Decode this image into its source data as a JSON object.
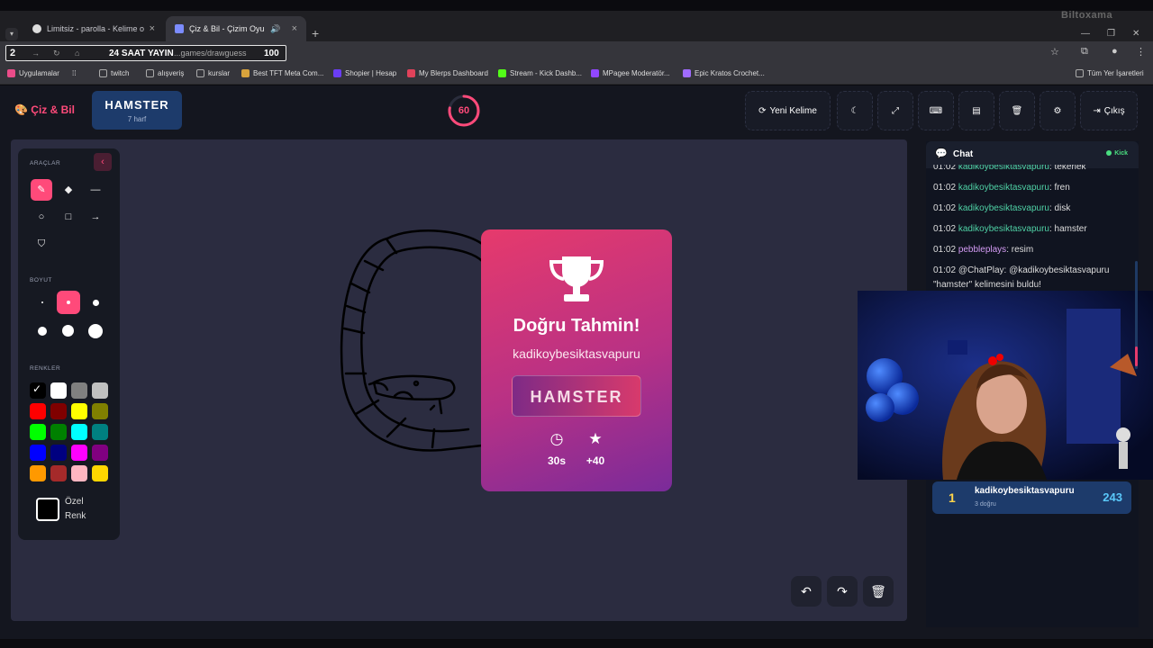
{
  "browser": {
    "tabs": [
      {
        "title": "Limitsiz - parolla - Kelime oyunu"
      },
      {
        "title": "Çiz & Bil - Çizim Oyunu"
      }
    ],
    "brand_overlay": "Biltoxama",
    "address": {
      "overlay_number": "2",
      "overlay_live": "24 SAAT YAYIN",
      "url": "...games/drawguess",
      "overlay_count": "100"
    },
    "bookmarks": [
      {
        "label": "Uygulamalar",
        "color": "#ea4c89"
      },
      {
        "label": "twitch",
        "color": "#9aa0a6"
      },
      {
        "label": "alışveriş",
        "color": "#9aa0a6"
      },
      {
        "label": "kurslar",
        "color": "#9aa0a6"
      },
      {
        "label": "Best TFT Meta Com...",
        "color": "#d8a33c"
      },
      {
        "label": "Shopier | Hesap",
        "color": "#6a3df5"
      },
      {
        "label": "My Blerps Dashboard",
        "color": "#e0425a"
      },
      {
        "label": "Stream - Kick Dashb...",
        "color": "#53fc18"
      },
      {
        "label": "MPagee Moderatör...",
        "color": "#9147ff"
      },
      {
        "label": "Epic Kratos Crochet...",
        "color": "#a06bff"
      },
      {
        "label": "Tüm Yer İşaretleri",
        "color": "#9aa0a6"
      }
    ]
  },
  "app": {
    "logo": "Çiz & Bil",
    "word": "HAMSTER",
    "letters": "7 harf",
    "timer": "60",
    "timer_progress": 0.78,
    "new_word_label": "Yeni Kelime",
    "exit_label": "Çıkış",
    "accent": "#ff4a7a"
  },
  "tools": {
    "section_tools": "ARAÇLAR",
    "section_size": "BOYUT",
    "section_colors": "RENKLER",
    "custom_color_line1": "Özel",
    "custom_color_line2": "Renk",
    "palette": [
      "#000000",
      "#ffffff",
      "#808080",
      "#c0c0c0",
      "#ff0000",
      "#800000",
      "#ffff00",
      "#808000",
      "#00ff00",
      "#008000",
      "#00ffff",
      "#008080",
      "#0000ff",
      "#000080",
      "#ff00ff",
      "#800080",
      "#ff9900",
      "#a52a2a",
      "#ffb6c1",
      "#ffd700"
    ]
  },
  "result": {
    "title": "Doğru Tahmin!",
    "winner": "kadikoybesiktasvapuru",
    "word": "HAMSTER",
    "time": "30s",
    "points": "+40"
  },
  "chat": {
    "title": "Chat",
    "platform": "Kick",
    "messages": [
      {
        "time": "01:02",
        "user": "kadikoybesiktasvapuru",
        "text": ": tekerlek"
      },
      {
        "time": "01:02",
        "user": "kadikoybesiktasvapuru",
        "text": ": fren"
      },
      {
        "time": "01:02",
        "user": "kadikoybesiktasvapuru",
        "text": ": disk"
      },
      {
        "time": "01:02",
        "user": "kadikoybesiktasvapuru",
        "text": ": hamster"
      },
      {
        "time": "01:02",
        "user": "pebbleplays",
        "text": ": resim"
      },
      {
        "time": "01:02",
        "user": "",
        "text": "@ChatPlay: @kadikoybesiktasvapuru"
      },
      {
        "time": "",
        "user": "",
        "text": "\"hamster\" kelimesini buldu!"
      }
    ]
  },
  "leaderboard": [
    {
      "rank": "1",
      "name": "kadikoybesiktasvapuru",
      "correct": "3 doğru",
      "score": "243"
    }
  ]
}
